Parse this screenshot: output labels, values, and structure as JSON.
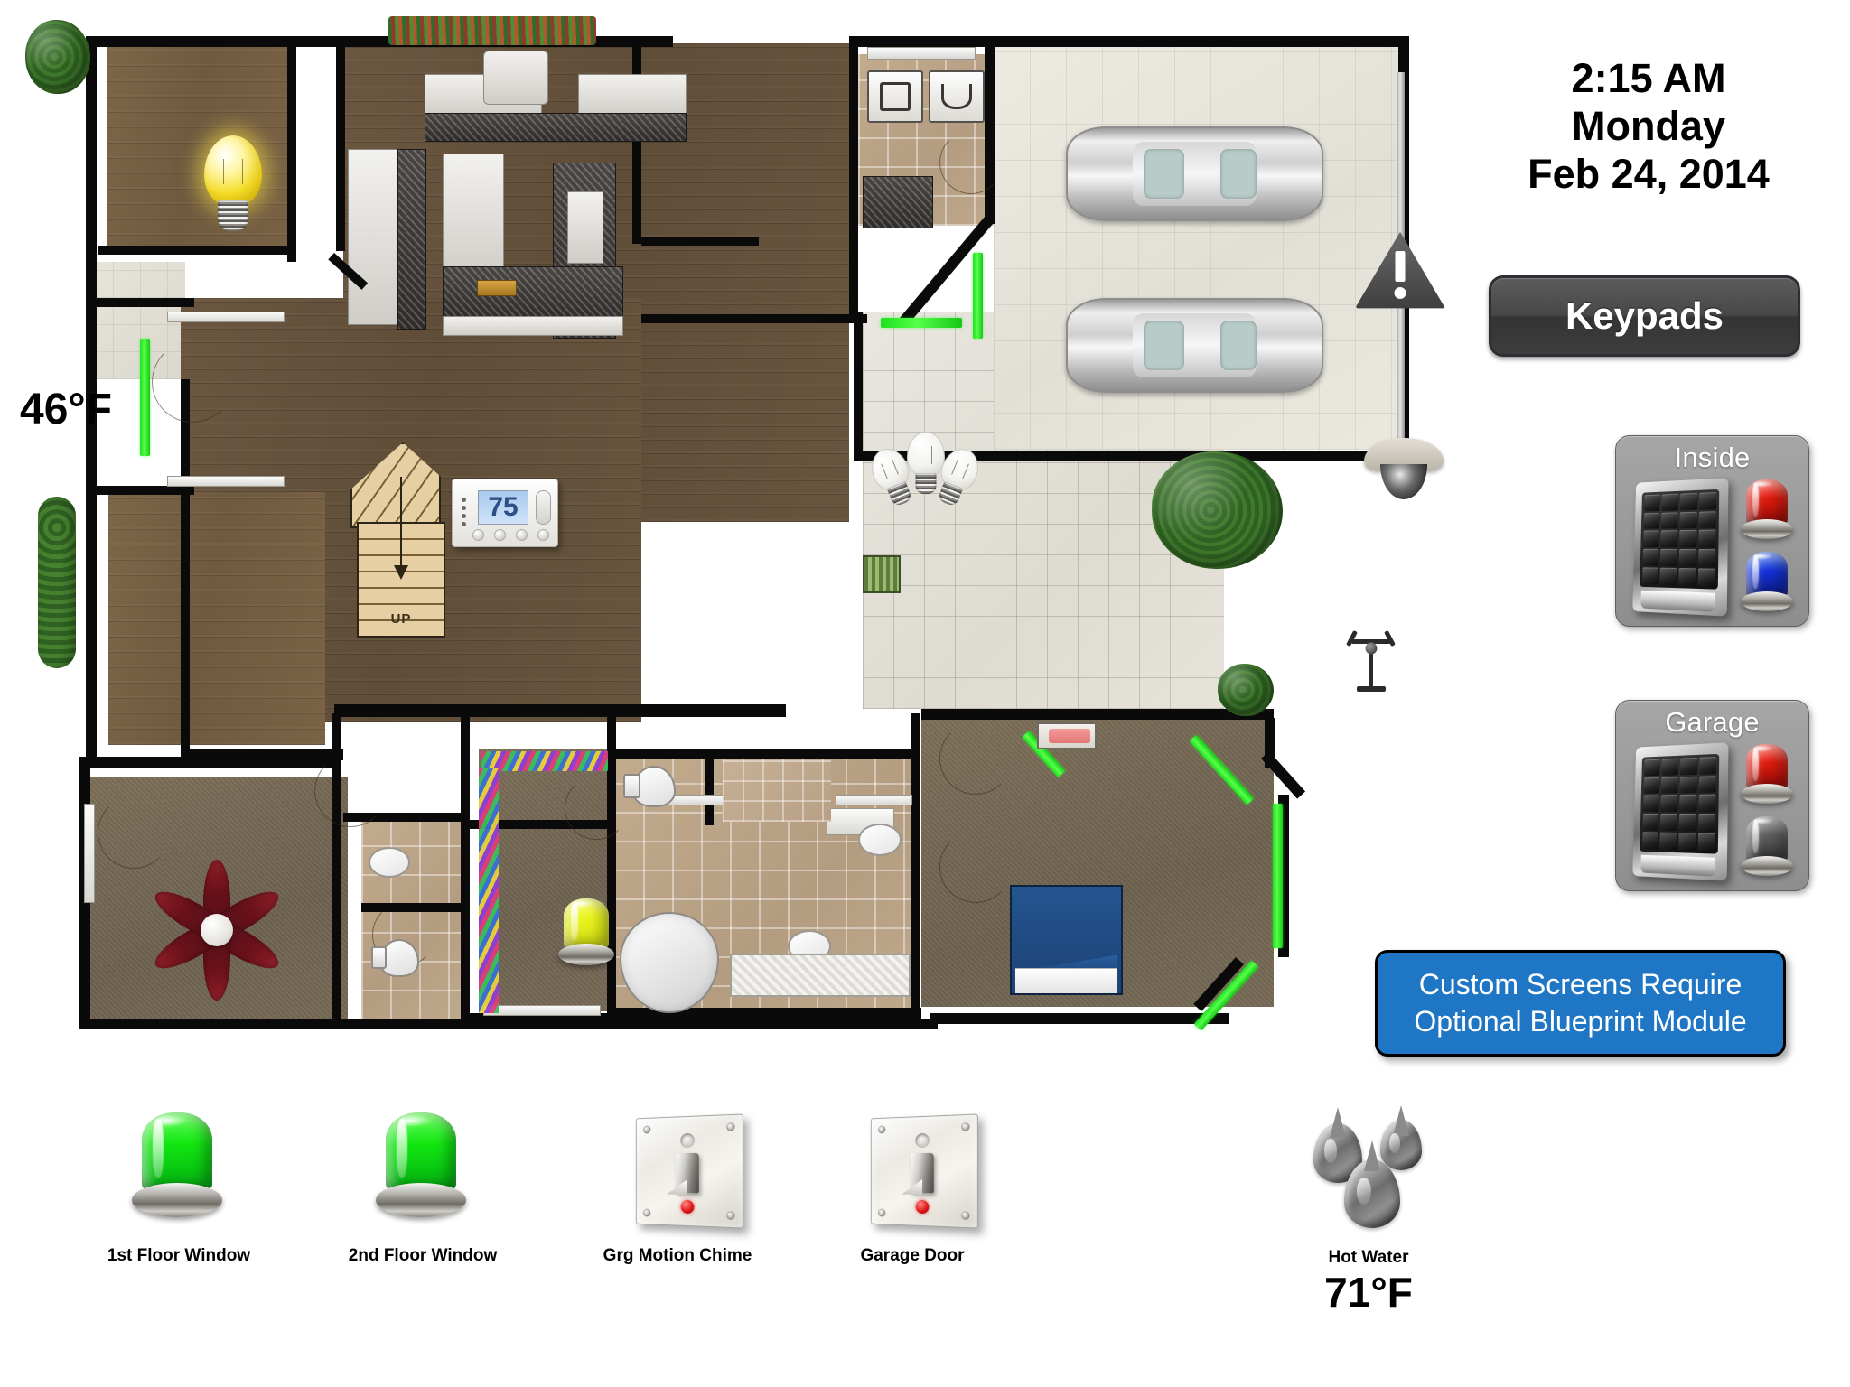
{
  "header": {
    "time": "2:15 AM",
    "weekday": "Monday",
    "date": "Feb 24, 2014"
  },
  "outdoor": {
    "temperature": "46°F"
  },
  "thermostat": {
    "setpoint": "75"
  },
  "stairs": {
    "direction_label": "UP"
  },
  "buttons": {
    "keypads": "Keypads"
  },
  "panels": [
    {
      "title": "Inside",
      "lights": [
        "red",
        "blue"
      ]
    },
    {
      "title": "Garage",
      "lights": [
        "red",
        "grey"
      ]
    }
  ],
  "notice": {
    "line1": "Custom Screens Require",
    "line2": "Optional Blueprint Module",
    "bg_color": "#1f76c4",
    "text_color": "#ffffff"
  },
  "status_bar": [
    {
      "label": "1st Floor Window",
      "icon": "beacon-green-icon",
      "state": "green",
      "value": ""
    },
    {
      "label": "2nd Floor Window",
      "icon": "beacon-green-icon",
      "state": "green",
      "value": ""
    },
    {
      "label": "Grg Motion Chime",
      "icon": "switch-plate-icon",
      "state": "off",
      "value": ""
    },
    {
      "label": "Garage Door",
      "icon": "switch-plate-icon",
      "state": "off",
      "value": ""
    },
    {
      "label": "Hot Water",
      "icon": "water-drops-icon",
      "state": "off",
      "value": "71°F"
    }
  ],
  "floorplan": {
    "icons": [
      {
        "name": "light-bulb-on-icon",
        "state": "on",
        "color": "#f5e13a"
      },
      {
        "name": "chandelier-lights-off-icon",
        "state": "off",
        "color": "#ffffff"
      },
      {
        "name": "ceiling-fan-icon",
        "state": "off",
        "color": "#6a1119"
      },
      {
        "name": "beacon-yellow-icon",
        "state": "yellow",
        "color": "#e9f22a"
      },
      {
        "name": "security-camera-icon",
        "state": "on"
      },
      {
        "name": "warning-triangle-icon",
        "state": "alert"
      },
      {
        "name": "sprinkler-icon",
        "state": "off"
      },
      {
        "name": "thermostat-icon",
        "state": "on"
      }
    ],
    "sensor_color": "#3ff03f",
    "sensor_count": 9
  }
}
